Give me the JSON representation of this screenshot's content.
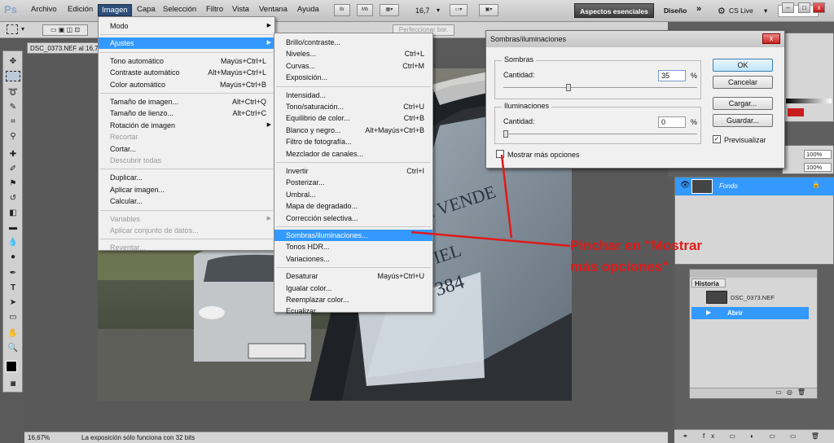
{
  "menubar": {
    "logo": "Ps",
    "items": [
      "Archivo",
      "Edición",
      "Imagen",
      "Capa",
      "Selección",
      "Filtro",
      "Vista",
      "Ventana",
      "Ayuda"
    ],
    "active_item": "Imagen",
    "icon_br": "Br",
    "icon_mb": "Mb",
    "zoom": "16,7",
    "workspace": "Aspectos esenciales",
    "workspace_alt": "Diseño",
    "more": "»",
    "cslive": "CS Live"
  },
  "optbar": {
    "refine_edge": "Perfeccionar bor."
  },
  "document": {
    "tab": "DSC_0373.NEF al 16,7%",
    "status_zoom": "16,67%",
    "status_text": "La exposición sólo funciona con 32 bits"
  },
  "image_menu": [
    {
      "label": "Modo",
      "arrow": true
    },
    {
      "sep": true
    },
    {
      "label": "Ajustes",
      "arrow": true,
      "highlight": true
    },
    {
      "sep": true
    },
    {
      "label": "Tono automático",
      "shortcut": "Mayús+Ctrl+L"
    },
    {
      "label": "Contraste automático",
      "shortcut": "Alt+Mayús+Ctrl+L"
    },
    {
      "label": "Color automático",
      "shortcut": "Mayús+Ctrl+B"
    },
    {
      "sep": true
    },
    {
      "label": "Tamaño de imagen...",
      "shortcut": "Alt+Ctrl+Q"
    },
    {
      "label": "Tamaño de lienzo...",
      "shortcut": "Alt+Ctrl+C"
    },
    {
      "label": "Rotación de imagen",
      "arrow": true
    },
    {
      "label": "Recortar",
      "disabled": true
    },
    {
      "label": "Cortar..."
    },
    {
      "label": "Descubrir todas",
      "disabled": true
    },
    {
      "sep": true
    },
    {
      "label": "Duplicar..."
    },
    {
      "label": "Aplicar imagen..."
    },
    {
      "label": "Calcular..."
    },
    {
      "sep": true
    },
    {
      "label": "Variables",
      "arrow": true,
      "disabled": true
    },
    {
      "label": "Aplicar conjunto de datos...",
      "disabled": true
    },
    {
      "sep": true
    },
    {
      "label": "Reventar...",
      "disabled": true
    }
  ],
  "adjust_menu": [
    {
      "label": "Brillo/contraste..."
    },
    {
      "label": "Niveles...",
      "shortcut": "Ctrl+L"
    },
    {
      "label": "Curvas...",
      "shortcut": "Ctrl+M"
    },
    {
      "label": "Exposición..."
    },
    {
      "sep": true
    },
    {
      "label": "Intensidad..."
    },
    {
      "label": "Tono/saturación...",
      "shortcut": "Ctrl+U"
    },
    {
      "label": "Equilibrio de color...",
      "shortcut": "Ctrl+B"
    },
    {
      "label": "Blanco y negro...",
      "shortcut": "Alt+Mayús+Ctrl+B"
    },
    {
      "label": "Filtro de fotografía..."
    },
    {
      "label": "Mezclador de canales..."
    },
    {
      "sep": true
    },
    {
      "label": "Invertir",
      "shortcut": "Ctrl+I"
    },
    {
      "label": "Posterizar..."
    },
    {
      "label": "Umbral..."
    },
    {
      "label": "Mapa de degradado..."
    },
    {
      "label": "Corrección selectiva..."
    },
    {
      "sep": true
    },
    {
      "label": "Sombras/iluminaciones...",
      "highlight": true
    },
    {
      "label": "Tonos HDR..."
    },
    {
      "label": "Variaciones..."
    },
    {
      "sep": true
    },
    {
      "label": "Desaturar",
      "shortcut": "Mayús+Ctrl+U"
    },
    {
      "label": "Igualar color..."
    },
    {
      "label": "Reemplazar color..."
    },
    {
      "label": "Ecualizar"
    }
  ],
  "dialog": {
    "title": "Sombras/iluminaciones",
    "close": "x",
    "shadows": {
      "group": "Sombras",
      "label": "Cantidad:",
      "value": "35",
      "unit": "%",
      "level_percent": 35
    },
    "highlights": {
      "group": "Iluminaciones",
      "label": "Cantidad:",
      "value": "0",
      "unit": "%",
      "level_percent": 0
    },
    "more_options": "Mostrar más opciones",
    "preview": "Previsualizar",
    "buttons": {
      "ok": "OK",
      "cancel": "Cancelar",
      "load": "Cargar...",
      "save": "Guardar..."
    }
  },
  "layers": {
    "layer_name": "Fondo",
    "percent1": "100%",
    "percent2": "100%"
  },
  "history": {
    "title": "Historia",
    "snapshot": "DSC_0373.NEF",
    "step": "Abrir"
  },
  "annotation": {
    "line1": "Pinchar en \"Mostrar",
    "line2": "más opciones\""
  },
  "photo_text": {
    "l1": "SE VENDE",
    "l2": "VIEL",
    "l3": "9 384"
  },
  "colors": {
    "accent": "#3399ff",
    "annotation": "#e01a1a",
    "dark_ui": "#5a5a5a"
  }
}
